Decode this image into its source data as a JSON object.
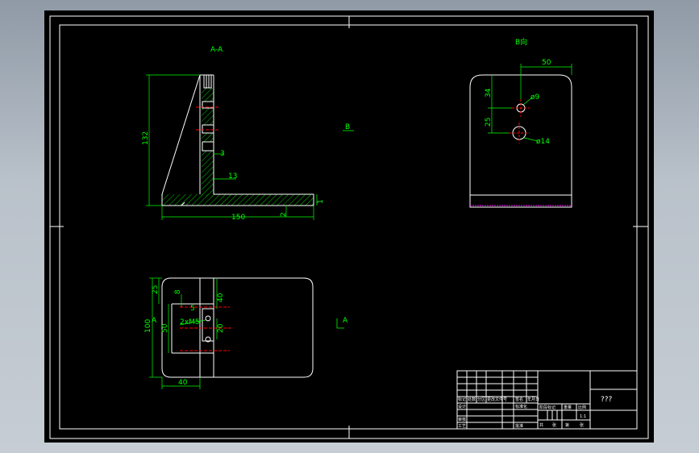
{
  "drawing": {
    "section_label": "A-A",
    "view_b_label": "B向",
    "b_marker": "B",
    "a_marker": "A",
    "a_marker_left": "A"
  },
  "section_view": {
    "dims": {
      "height": "132",
      "length": "150",
      "d3": "3",
      "d13": "13",
      "d2": "2",
      "d1": "1"
    }
  },
  "view_b": {
    "dims": {
      "width": "50",
      "d34": "34",
      "d25": "25",
      "hole_small": "ø9",
      "hole_large": "ø14"
    }
  },
  "top_view": {
    "dims": {
      "d25": "25",
      "d8": "8",
      "d40_right": "40",
      "d100": "100",
      "d50": "50",
      "d20": "20",
      "d5": "5",
      "thread": "2xM5",
      "d40_bottom": "40"
    }
  },
  "title_block": {
    "title": "???",
    "row_a": [
      "标记",
      "处数",
      "分区",
      "更改文件号",
      "签名",
      "年月日"
    ],
    "row_b": [
      "设计",
      "",
      "标准化"
    ],
    "row_c": [
      "审核",
      ""
    ],
    "row_d": [
      "工艺",
      "",
      "批准"
    ],
    "stage": [
      "阶段标记",
      "重量",
      "比例"
    ],
    "scale": "1:1",
    "bottom": [
      "共",
      "张",
      "第",
      "张"
    ]
  },
  "colors": {
    "outline": "#ffffff",
    "dimension": "#00ff00",
    "centerline": "#ff0000",
    "hatch": "#00ff00",
    "accent": "#ff00ff"
  }
}
